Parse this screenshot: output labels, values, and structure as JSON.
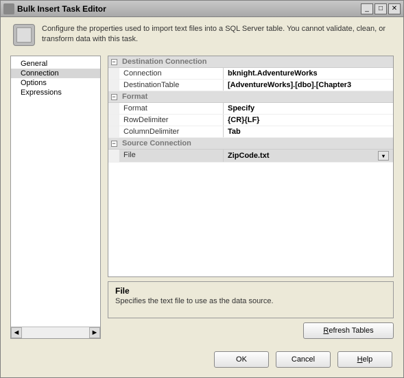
{
  "window": {
    "title": "Bulk Insert Task Editor"
  },
  "description": "Configure the properties used to import text files into a SQL Server table. You cannot validate, clean, or transform data with this task.",
  "sidebar": {
    "items": [
      {
        "label": "General",
        "selected": false
      },
      {
        "label": "Connection",
        "selected": true
      },
      {
        "label": "Options",
        "selected": false
      },
      {
        "label": "Expressions",
        "selected": false
      }
    ]
  },
  "categories": {
    "destination": {
      "label": "Destination Connection",
      "props": {
        "connection_label": "Connection",
        "connection_value": "bknight.AdventureWorks",
        "table_label": "DestinationTable",
        "table_value": "[AdventureWorks].[dbo].[Chapter3"
      }
    },
    "format": {
      "label": "Format",
      "props": {
        "format_label": "Format",
        "format_value": "Specify",
        "rowdelim_label": "RowDelimiter",
        "rowdelim_value": "{CR}{LF}",
        "coldelim_label": "ColumnDelimiter",
        "coldelim_value": "Tab"
      }
    },
    "source": {
      "label": "Source Connection",
      "props": {
        "file_label": "File",
        "file_value": "ZipCode.txt"
      }
    }
  },
  "help_panel": {
    "title": "File",
    "desc": "Specifies the text file to use as the data source."
  },
  "buttons": {
    "refresh": "Refresh Tables",
    "ok": "OK",
    "cancel": "Cancel",
    "help": "Help"
  },
  "glyphs": {
    "minus": "−",
    "dropdown": "▾",
    "left": "◄",
    "right": "►",
    "min": "_",
    "max": "□",
    "close": "✕"
  }
}
